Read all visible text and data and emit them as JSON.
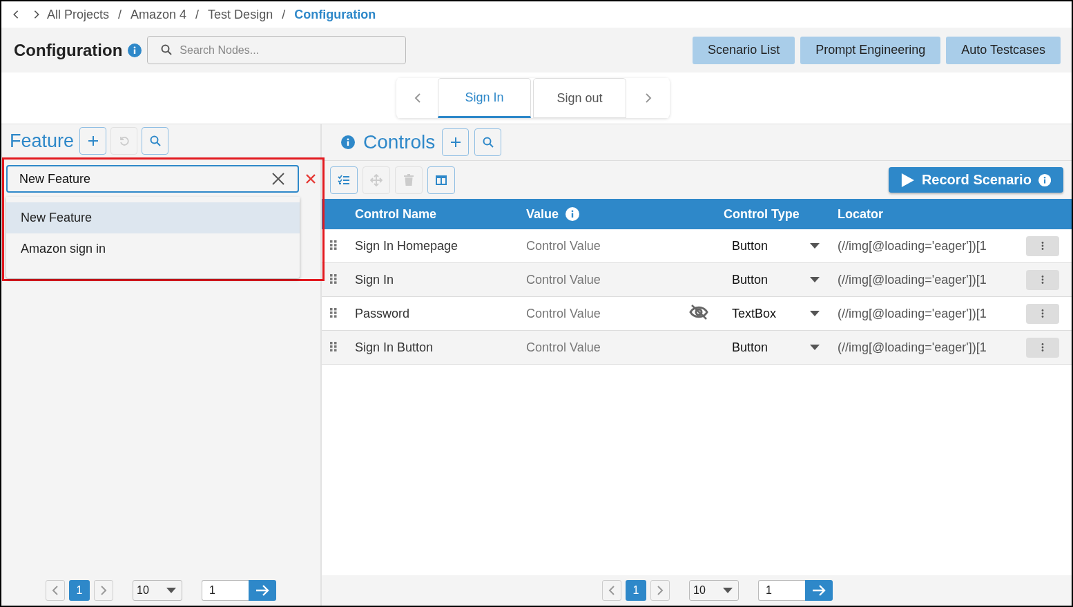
{
  "breadcrumbs": [
    {
      "label": "All Projects",
      "current": false
    },
    {
      "separator": "/",
      "label": "Amazon 4",
      "current": false
    },
    {
      "separator": "/",
      "label": "Test Design",
      "current": false
    },
    {
      "separator": "/",
      "label": "Configuration",
      "current": true
    }
  ],
  "header": {
    "title": "Configuration",
    "search": {
      "placeholder": "Search Nodes..."
    },
    "buttons": [
      "Scenario List",
      "Prompt Engineering",
      "Auto Testcases"
    ]
  },
  "scenario_tabs": [
    {
      "label": "Sign In",
      "selected": true
    },
    {
      "label": "Sign out",
      "selected": false
    }
  ],
  "feature_panel": {
    "title": "Feature",
    "toolbar": [
      {
        "kind": "add",
        "disabled": false
      },
      {
        "kind": "undo",
        "disabled": true
      },
      {
        "kind": "search",
        "disabled": false
      }
    ],
    "name_input": {
      "value": "New Feature"
    },
    "options": [
      {
        "label": "New Feature",
        "selected": true
      },
      {
        "label": "Amazon sign in",
        "selected": false
      }
    ],
    "pagination": {
      "pages": [
        {
          "label": "1",
          "selected": true
        }
      ],
      "page_size": "10",
      "goto": "1"
    }
  },
  "controls_panel": {
    "title": "Controls",
    "title_buttons": [
      {
        "kind": "add",
        "disabled": false
      },
      {
        "kind": "search",
        "disabled": false
      }
    ],
    "toolbar": [
      {
        "kind": "checklist",
        "disabled": false
      },
      {
        "kind": "move",
        "disabled": true
      },
      {
        "kind": "delete",
        "disabled": true
      },
      {
        "kind": "columns",
        "disabled": false
      }
    ],
    "record_button": "Record Scenario",
    "columns": [
      "Control Name",
      "Value",
      "Control Type",
      "Locator"
    ],
    "rows": [
      {
        "name": "Sign In Homepage",
        "value": "Control Value",
        "masked": false,
        "type": "Button",
        "locator": "(//img[@loading='eager'])[1"
      },
      {
        "name": "Sign In",
        "value": "Control Value",
        "masked": false,
        "type": "Button",
        "locator": "(//img[@loading='eager'])[1"
      },
      {
        "name": "Password",
        "value": "Control Value",
        "masked": true,
        "type": "TextBox",
        "locator": "(//img[@loading='eager'])[1"
      },
      {
        "name": "Sign In Button",
        "value": "Control Value",
        "masked": false,
        "type": "Button",
        "locator": "(//img[@loading='eager'])[1"
      }
    ],
    "pagination": {
      "pages": [
        {
          "label": "1",
          "selected": true
        }
      ],
      "page_size": "10",
      "goto": "1"
    }
  }
}
